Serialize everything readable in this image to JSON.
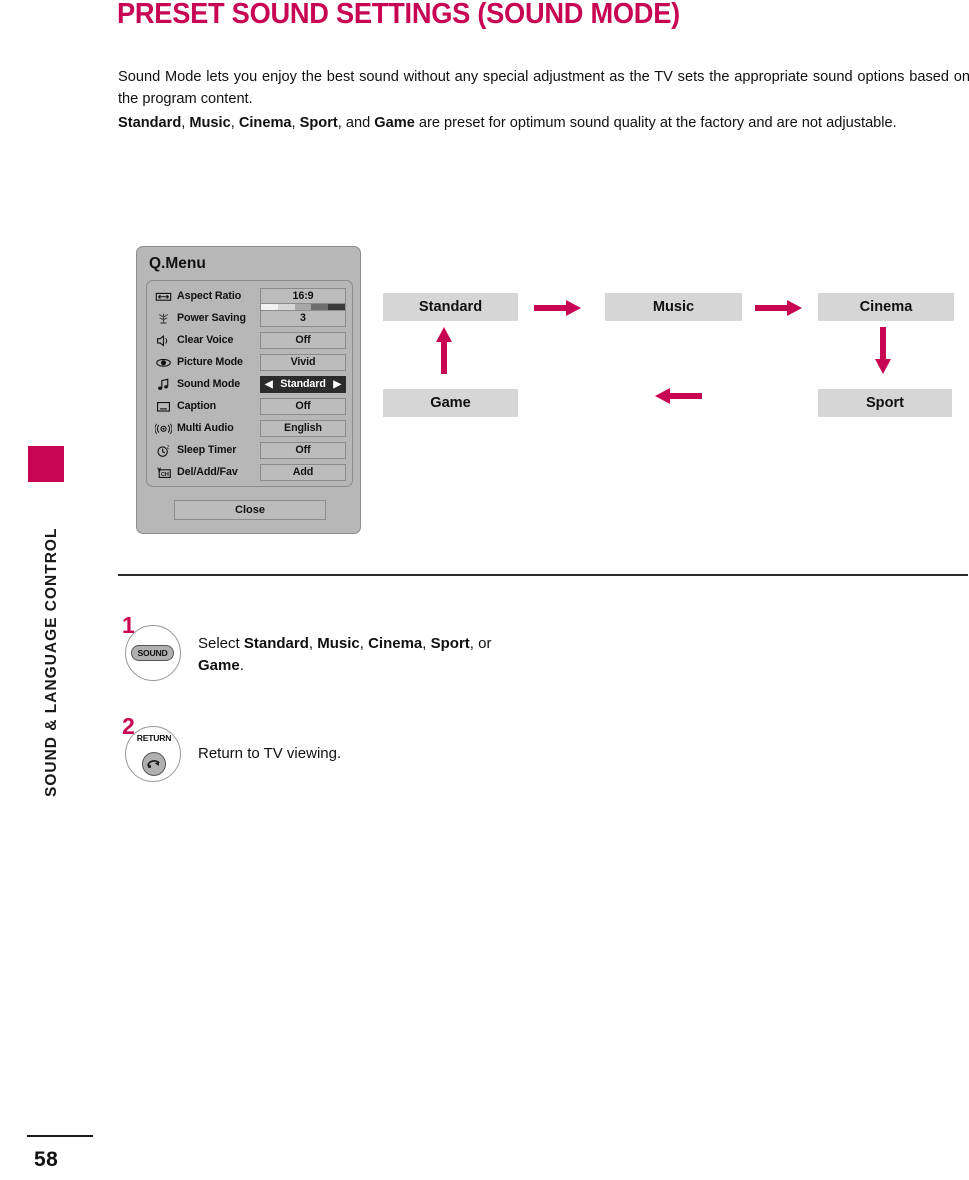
{
  "page": {
    "title": "PRESET SOUND SETTINGS (SOUND MODE)",
    "number": "58",
    "sidebar_label": "SOUND & LANGUAGE CONTROL",
    "accent_color": "#c80552"
  },
  "intro": {
    "paragraph1": "Sound Mode lets you enjoy the best sound without any special adjustment as the TV sets the appropriate sound options based on the program content.",
    "paragraph2_modes": [
      "Standard",
      "Music",
      "Cinema",
      "Sport",
      "Game"
    ],
    "paragraph2_prefix": "",
    "paragraph2_join": ", and ",
    "paragraph2_suffix": " are preset for optimum sound quality at the factory and are not adjustable."
  },
  "qmenu": {
    "title": "Q.Menu",
    "close_label": "Close",
    "items": [
      {
        "icon": "aspect-ratio-icon",
        "label": "Aspect Ratio",
        "value": "16:9",
        "selected": false
      },
      {
        "icon": "power-saving-icon",
        "label": "Power Saving",
        "value": "3",
        "selected": false,
        "gauge": true,
        "gauge_levels": 5,
        "gauge_colors": [
          "#f2f2f2",
          "#d6d6d6",
          "#a8a8a8",
          "#6e6e6e",
          "#3a3a3a"
        ]
      },
      {
        "icon": "clear-voice-icon",
        "label": "Clear Voice",
        "value": "Off",
        "selected": false
      },
      {
        "icon": "picture-mode-icon",
        "label": "Picture Mode",
        "value": "Vivid",
        "selected": false
      },
      {
        "icon": "sound-mode-icon",
        "label": "Sound Mode",
        "value": "Standard",
        "selected": true,
        "arrow_left": "◀",
        "arrow_right": "▶"
      },
      {
        "icon": "caption-icon",
        "label": "Caption",
        "value": "Off",
        "selected": false
      },
      {
        "icon": "multi-audio-icon",
        "label": "Multi Audio",
        "value": "English",
        "selected": false
      },
      {
        "icon": "sleep-timer-icon",
        "label": "Sleep Timer",
        "value": "Off",
        "selected": false
      },
      {
        "icon": "del-add-fav-icon",
        "label": "Del/Add/Fav",
        "value": "Add",
        "selected": false
      }
    ]
  },
  "flow": {
    "boxes": {
      "standard": "Standard",
      "music": "Music",
      "cinema": "Cinema",
      "sport": "Sport",
      "game": "Game"
    },
    "arrow_color": "#c80552",
    "sequence": [
      "Standard",
      "Music",
      "Cinema",
      "Sport",
      "Game"
    ]
  },
  "steps": [
    {
      "number": "1",
      "button_label": "SOUND",
      "button_type": "pill",
      "text_prefix": "Select ",
      "text_modes": [
        "Standard",
        "Music",
        "Cinema",
        "Sport",
        "Game"
      ],
      "text_suffix": "."
    },
    {
      "number": "2",
      "button_label": "RETURN",
      "button_type": "disc",
      "text": "Return to TV viewing."
    }
  ]
}
